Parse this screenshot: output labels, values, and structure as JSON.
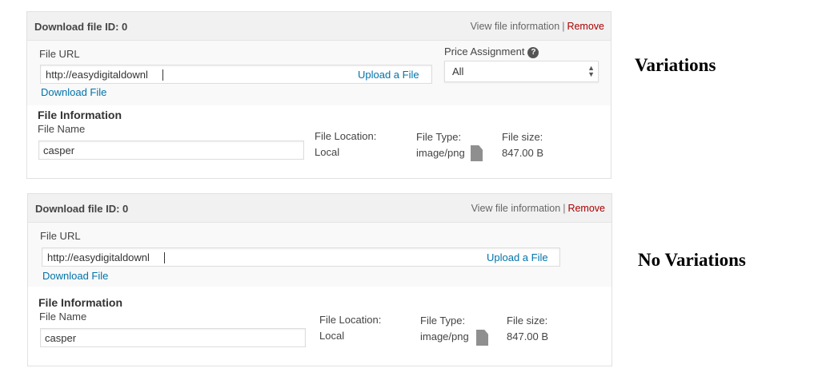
{
  "panels": [
    {
      "header": {
        "title": "Download file ID: 0",
        "view_link": "View file information",
        "separator": "|",
        "remove_link": "Remove"
      },
      "file_url": {
        "label": "File URL",
        "value": "http://easydigitaldownl",
        "upload_label": "Upload a File",
        "download_link": "Download File"
      },
      "price_assignment": {
        "label": "Price Assignment",
        "help_icon": "?",
        "selected": "All"
      },
      "file_info": {
        "title": "File Information",
        "name_label": "File Name",
        "name_value": "casper",
        "location_label": "File Location:",
        "location_value": "Local",
        "type_label": "File Type:",
        "type_value": "image/png",
        "type_icon": "file-icon",
        "size_label": "File size:",
        "size_value": "847.00 B"
      }
    },
    {
      "header": {
        "title": "Download file ID: 0",
        "view_link": "View file information",
        "separator": "|",
        "remove_link": "Remove"
      },
      "file_url": {
        "label": "File URL",
        "value": "http://easydigitaldownl",
        "upload_label": "Upload a File",
        "download_link": "Download File"
      },
      "file_info": {
        "title": "File Information",
        "name_label": "File Name",
        "name_value": "casper",
        "location_label": "File Location:",
        "location_value": "Local",
        "type_label": "File Type:",
        "type_value": "image/png",
        "type_icon": "file-icon",
        "size_label": "File size:",
        "size_value": "847.00 B"
      }
    }
  ],
  "side_labels": {
    "variations": "Variations",
    "no_variations": "No Variations"
  },
  "colors": {
    "link": "#0073aa",
    "remove": "#aa0000",
    "header_bg": "#f1f1f1"
  }
}
